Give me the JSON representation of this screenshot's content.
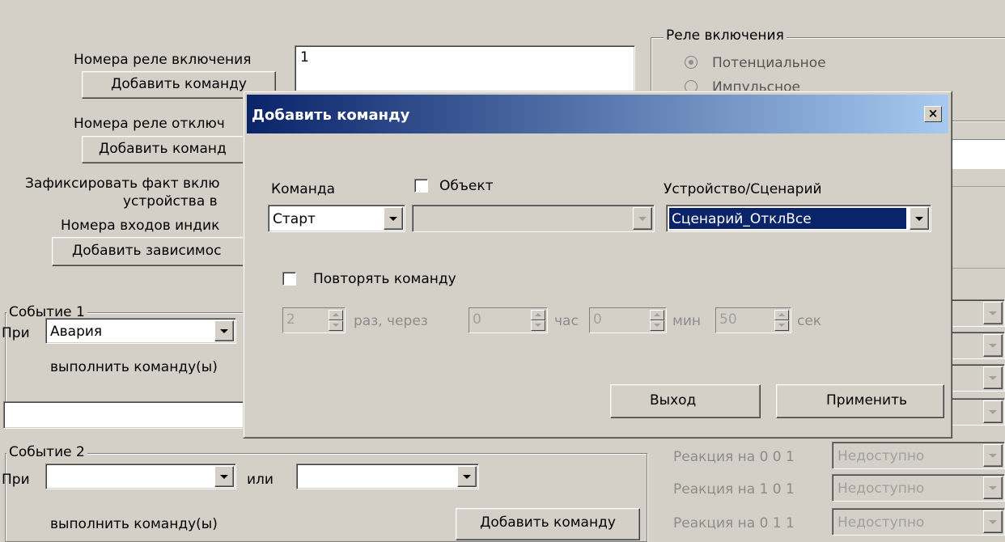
{
  "main": {
    "relay_on_numbers_label": "Номера реле включения",
    "relay_on_numbers_value": "1",
    "add_command_1": "Добавить команду",
    "relay_off_numbers_label": "Номера реле отключ",
    "add_command_2": "Добавить команд",
    "fix_fact_line1": "Зафиксировать факт вклю",
    "fix_fact_line2": "устройства в",
    "inputs_label": "Номера входов индик",
    "add_dependency": "Добавить зависимос",
    "event1": {
      "title": "Событие 1",
      "at_label": "При",
      "at_value": "Авария",
      "execute_label": "выполнить команду(ы)"
    },
    "event2": {
      "title": "Событие 2",
      "at_label": "При",
      "at_value": "",
      "or_label": "или",
      "or_value": "",
      "execute_label": "выполнить команду(ы)",
      "add_command": "Добавить команду"
    }
  },
  "relay_group": {
    "title": "Реле включения",
    "option1": "Потенциальное",
    "option2": "Импульсное"
  },
  "reactions": [
    {
      "label": "Реакция на  0  0  1",
      "value": "Недоступно"
    },
    {
      "label": "Реакция на  1  0  1",
      "value": "Недоступно"
    },
    {
      "label": "Реакция на  0  1  1",
      "value": "Недоступно"
    }
  ],
  "dialog": {
    "title": "Добавить команду",
    "close_glyph": "×",
    "command_label": "Команда",
    "command_value": "Старт",
    "object_checkbox_label": "Объект",
    "object_value": "",
    "device_label": "Устройство/Сценарий",
    "device_value": "Сценарий_ОтклВсе",
    "repeat_checkbox_label": "Повторять команду",
    "repeat": {
      "times_value": "2",
      "times_label": "раз, через",
      "hours_value": "0",
      "hours_label": "час",
      "minutes_value": "0",
      "minutes_label": "мин",
      "seconds_value": "50",
      "seconds_label": "сек"
    },
    "exit_button": "Выход",
    "apply_button": "Применить"
  }
}
